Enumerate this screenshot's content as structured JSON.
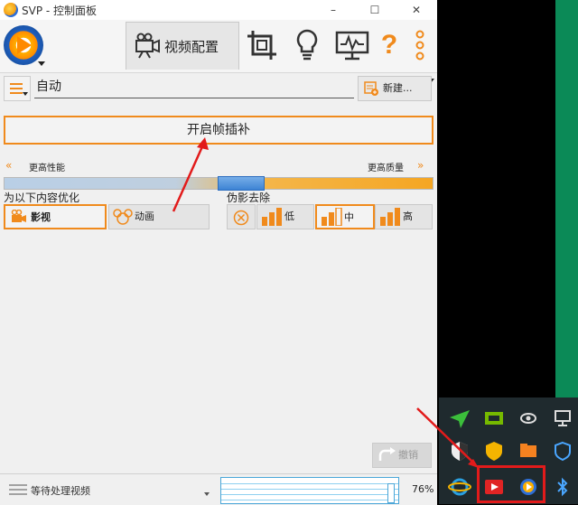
{
  "window": {
    "title": "SVP - 控制面板",
    "minimize": "–",
    "maximize": "☐",
    "close": "✕"
  },
  "toolbar": {
    "video_tab_label": "视频配置",
    "icons": [
      "video-camera-icon",
      "crop-icon",
      "lightbulb-icon",
      "monitor-icon",
      "help-icon",
      "more-icon"
    ]
  },
  "profile": {
    "name": "自动",
    "new_button": "新建..."
  },
  "main_button": "开启帧插补",
  "slider": {
    "left_label": "更高性能",
    "right_label": "更高质量",
    "position_fraction": 0.55
  },
  "optimize": {
    "label": "为以下内容优化",
    "options": [
      "影视",
      "动画"
    ],
    "selected": "影视"
  },
  "artifact": {
    "label": "伪影去除",
    "options": [
      "低",
      "中",
      "高"
    ],
    "selected": "中"
  },
  "undo_label": "撤销",
  "status": {
    "text": "等待处理视频",
    "percent": "76%"
  },
  "colors": {
    "accent": "#f08a1c",
    "highlight": "#e21b1b",
    "tray_bg": "#1f2a2e"
  }
}
